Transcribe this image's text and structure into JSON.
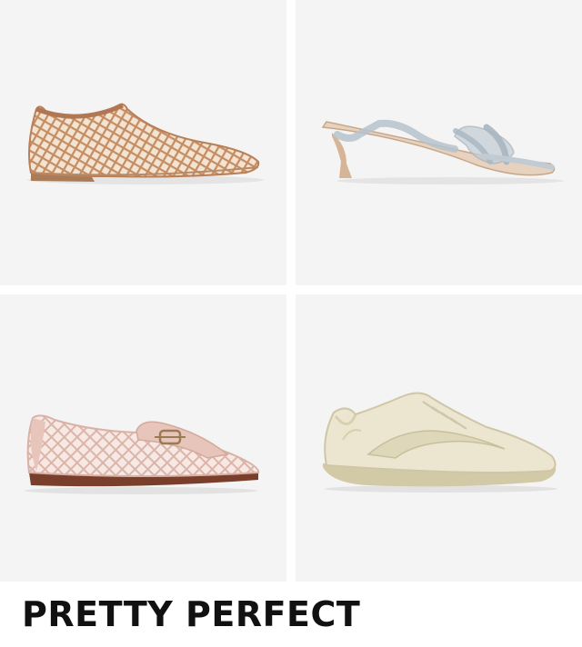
{
  "products": [
    {
      "id": "mesh-flat",
      "icon": "rose-gold-mesh-flat-shoe"
    },
    {
      "id": "kitten-heel",
      "icon": "clear-grey-kitten-heel-thong-sandal"
    },
    {
      "id": "mesh-loafer",
      "icon": "pink-mesh-horsebit-loafer"
    },
    {
      "id": "sneaker",
      "icon": "cream-patent-sneaker"
    }
  ],
  "headline": "PRETTY PERFECT",
  "colors": {
    "tile_bg": "#f4f4f4",
    "headline": "#111111",
    "mesh_gold": "#c9946a",
    "loafer_pink": "#e8c4bb",
    "sneaker_cream": "#e9e3cc",
    "sandal_grey": "#b8c3cc"
  }
}
